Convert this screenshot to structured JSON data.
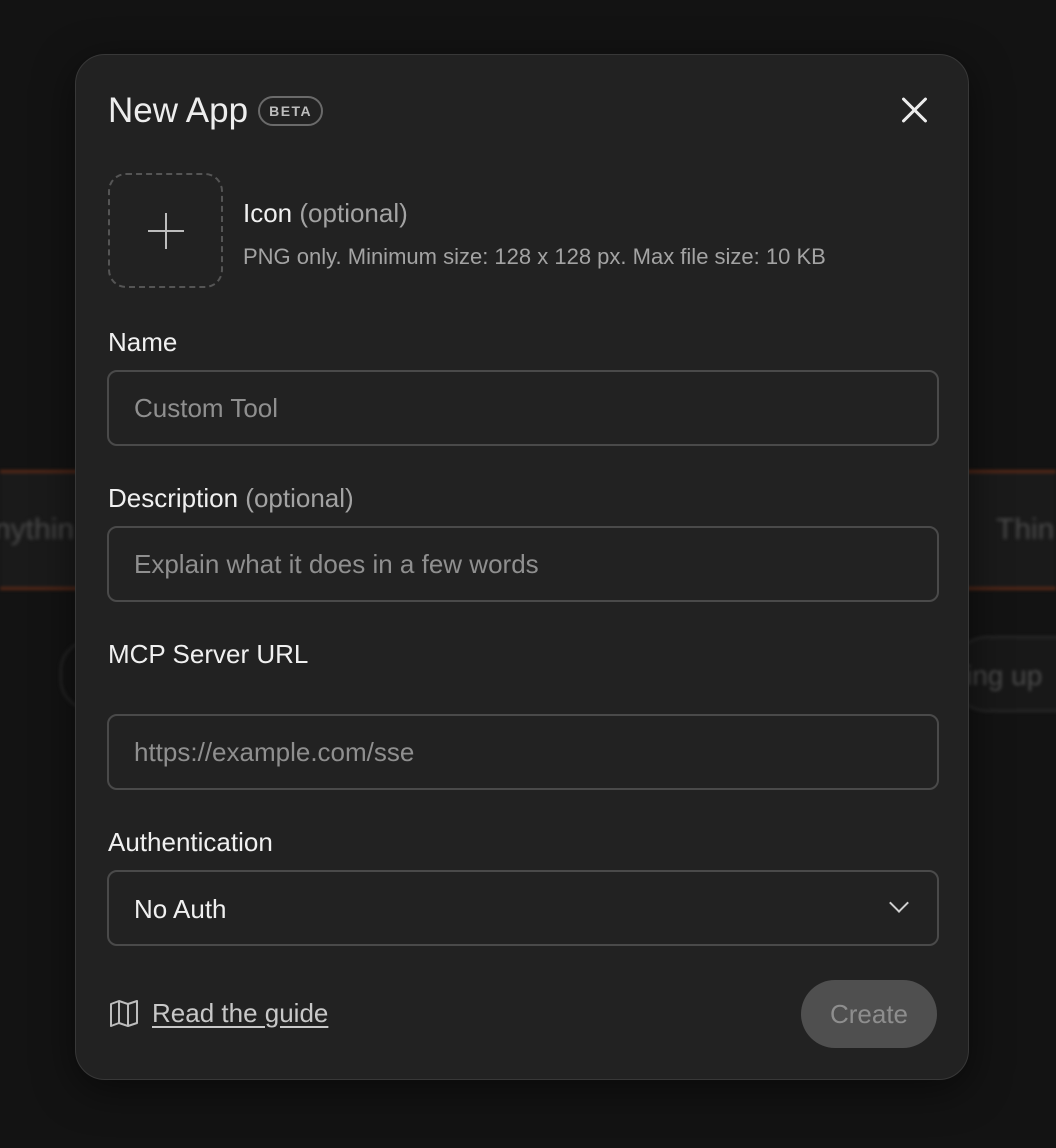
{
  "background": {
    "left_text": "nythin",
    "right_text": "Thin",
    "pill_text": "ing up"
  },
  "modal": {
    "title": "New App",
    "badge": "BETA",
    "close_icon": "close-icon",
    "icon_section": {
      "label": "Icon",
      "optional": "(optional)",
      "hint": "PNG only. Minimum size: 128 x 128 px. Max file size: 10 KB",
      "upload_icon": "plus-icon"
    },
    "name": {
      "label": "Name",
      "placeholder": "Custom Tool",
      "value": ""
    },
    "description": {
      "label": "Description",
      "optional": "(optional)",
      "placeholder": "Explain what it does in a few words",
      "value": ""
    },
    "server_url": {
      "label": "MCP Server URL",
      "placeholder": "https://example.com/sse",
      "value": ""
    },
    "authentication": {
      "label": "Authentication",
      "selected": "No Auth"
    },
    "footer": {
      "guide_label": "Read the guide",
      "guide_icon": "book-icon",
      "create_label": "Create"
    }
  }
}
